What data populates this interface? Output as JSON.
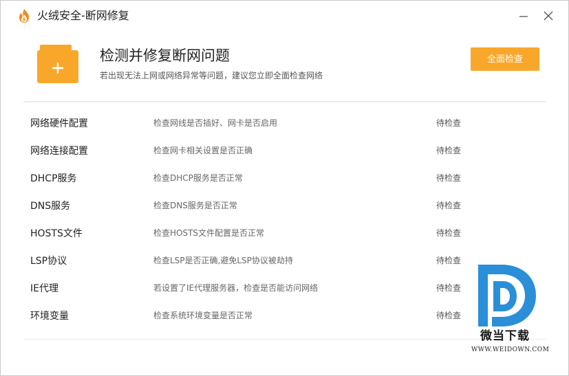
{
  "window": {
    "title": "火绒安全-断网修复",
    "minimize_icon": "minimize-icon",
    "close_icon": "close-icon",
    "logo_icon": "flame-logo-icon"
  },
  "header": {
    "icon": "folder-plus-icon",
    "title": "检测并修复断网问题",
    "subtitle": "若出现无法上网或网络异常等问题，建议您立即全面检查网络",
    "scan_button": "全面检查"
  },
  "rows": [
    {
      "name": "网络硬件配置",
      "desc": "检查网线是否插好、网卡是否启用",
      "status": "待检查"
    },
    {
      "name": "网络连接配置",
      "desc": "检查网卡相关设置是否正确",
      "status": "待检查"
    },
    {
      "name": "DHCP服务",
      "desc": "检查DHCP服务是否正常",
      "status": "待检查"
    },
    {
      "name": "DNS服务",
      "desc": "检查DNS服务是否正常",
      "status": "待检查"
    },
    {
      "name": "HOSTS文件",
      "desc": "检查HOSTS文件配置是否正常",
      "status": "待检查"
    },
    {
      "name": "LSP协议",
      "desc": "检查LSP是否正确,避免LSP协议被劫持",
      "status": "待检查"
    },
    {
      "name": "IE代理",
      "desc": "若设置了IE代理服务器，检查是否能访问网络",
      "status": "待检查"
    },
    {
      "name": "环境变量",
      "desc": "检查系统环境变量是否正常",
      "status": "待检查"
    }
  ],
  "watermark": {
    "text": "微当下载",
    "url": "WWW.WEIDOWN.COM"
  },
  "colors": {
    "accent": "#f9a72b",
    "watermark_blue": "#2a8fd8"
  }
}
